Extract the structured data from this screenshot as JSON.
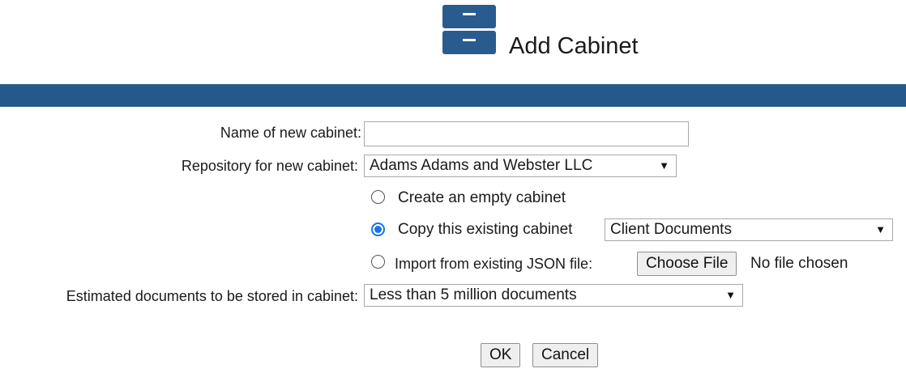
{
  "header": {
    "title": "Add Cabinet",
    "icon": "file-cabinet-icon",
    "band_color": "#26598b"
  },
  "form": {
    "name": {
      "label": "Name of new cabinet:",
      "value": ""
    },
    "repository": {
      "label": "Repository for new cabinet:",
      "selected": "Adams Adams and Webster LLC"
    },
    "options": {
      "empty": {
        "label": "Create an empty cabinet",
        "checked": false
      },
      "copy": {
        "label": "Copy this existing cabinet",
        "checked": true,
        "selected": "Client Documents"
      },
      "import": {
        "label": "Import from existing JSON file:",
        "checked": false,
        "button": "Choose File",
        "status": "No file chosen"
      }
    },
    "estimate": {
      "label": "Estimated documents to be stored in cabinet:",
      "selected": "Less than 5 million documents"
    }
  },
  "actions": {
    "ok": "OK",
    "cancel": "Cancel"
  },
  "colors": {
    "accent": "#1a73e8",
    "brand": "#2a5b8f"
  }
}
